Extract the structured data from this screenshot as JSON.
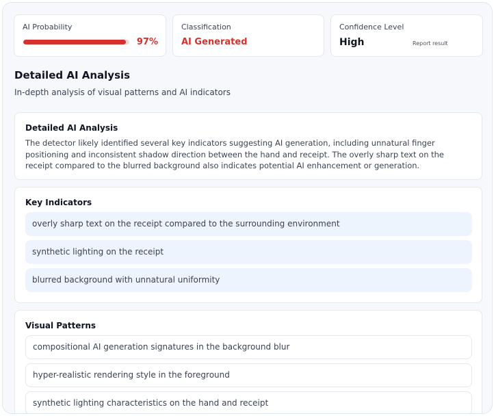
{
  "stats": {
    "probability": {
      "label": "AI Probability",
      "value": "97%",
      "fraction": 0.97,
      "color": "#d7312e"
    },
    "classification": {
      "label": "Classification",
      "value": "AI Generated",
      "color": "#d7312e"
    },
    "confidence": {
      "label": "Confidence Level",
      "value": "High",
      "report_label": "Report result"
    }
  },
  "section": {
    "title": "Detailed AI Analysis",
    "subtitle": "In-depth analysis of visual patterns and AI indicators"
  },
  "analysis": {
    "heading": "Detailed AI Analysis",
    "body": "The detector likely identified several key indicators suggesting AI generation, including unnatural finger positioning and inconsistent shadow direction between the hand and receipt. The overly sharp text on the receipt compared to the blurred background also indicates potential AI enhancement or generation."
  },
  "indicators": {
    "heading": "Key Indicators",
    "items": [
      "overly sharp text on the receipt compared to the surrounding environment",
      "synthetic lighting on the receipt",
      "blurred background with unnatural uniformity"
    ]
  },
  "patterns": {
    "heading": "Visual Patterns",
    "items": [
      "compositional AI generation signatures in the background blur",
      "hyper-realistic rendering style in the foreground",
      "synthetic lighting characteristics on the hand and receipt"
    ]
  }
}
